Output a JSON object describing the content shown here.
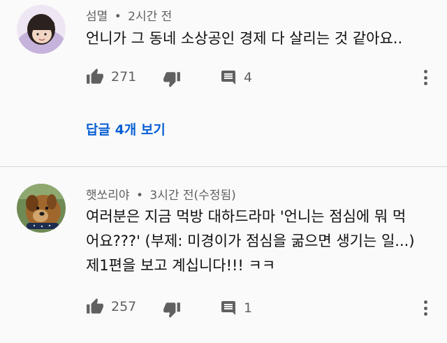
{
  "comments": [
    {
      "author": "섬멸",
      "time": "2시간 전",
      "lines": [
        "언니가 그 동네 소상공인 경제 다 살리는 것 같아요.."
      ],
      "likes": "271",
      "reply_count": "4",
      "replies_label": "답글 4개 보기"
    },
    {
      "author": "햇쏘리야",
      "time": "3시간 전(수정됨)",
      "lines": [
        "여러분은 지금 먹방 대하드라마 '언니는 점심에 뭐 먹",
        "어요???' (부제: 미경이가 점심을 굶으면 생기는 일...)",
        "제1편을 보고 계십니다!!! ㅋㅋ"
      ],
      "likes": "257",
      "reply_count": "1"
    }
  ],
  "separator": "•",
  "icons": {
    "like": "thumbs-up-icon",
    "dislike": "thumbs-down-icon",
    "reply": "comment-icon",
    "more": "more-vert-icon"
  },
  "colors": {
    "link": "#065fd4",
    "secondary_text": "#606060",
    "primary_text": "#0f0f0f"
  }
}
